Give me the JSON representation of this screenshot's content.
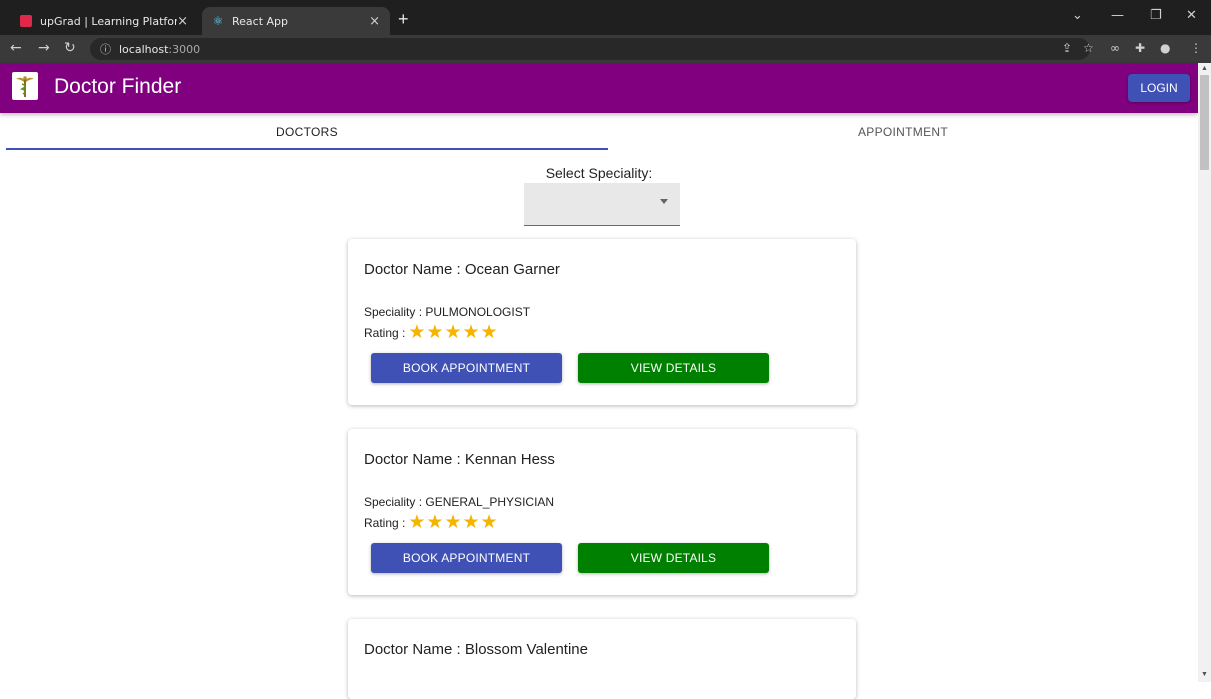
{
  "browser": {
    "tabs": [
      {
        "title": "upGrad | Learning Platform",
        "active": false
      },
      {
        "title": "React App",
        "active": true
      }
    ],
    "close_glyph": "×",
    "new_tab_glyph": "+",
    "url_host": "localhost",
    "url_port": ":3000",
    "icons": {
      "back": "back-arrow-icon",
      "forward": "forward-arrow-icon",
      "reload": "reload-icon",
      "info": "info-icon",
      "share": "share-icon",
      "bookmark": "star-icon",
      "extensions": "puzzle-icon",
      "menu": "kebab-menu-icon"
    }
  },
  "app": {
    "title": "Doctor Finder",
    "login_label": "LOGIN",
    "colors": {
      "appbar": "#800080",
      "primary": "#3f51b5",
      "success": "#008000",
      "star": "#f5b400"
    }
  },
  "tabs": [
    {
      "label": "DOCTORS",
      "selected": true
    },
    {
      "label": "APPOINTMENT",
      "selected": false
    }
  ],
  "speciality": {
    "label": "Select Speciality:",
    "selected": ""
  },
  "doctors": [
    {
      "name": "Doctor Name : Ocean Garner",
      "speciality": "Speciality : PULMONOLOGIST",
      "rating_label": "Rating :",
      "rating": 5,
      "book_label": "BOOK APPOINTMENT",
      "view_label": "VIEW DETAILS"
    },
    {
      "name": "Doctor Name : Kennan Hess",
      "speciality": "Speciality : GENERAL_PHYSICIAN",
      "rating_label": "Rating :",
      "rating": 5,
      "book_label": "BOOK APPOINTMENT",
      "view_label": "VIEW DETAILS"
    },
    {
      "name": "Doctor Name : Blossom Valentine"
    }
  ]
}
